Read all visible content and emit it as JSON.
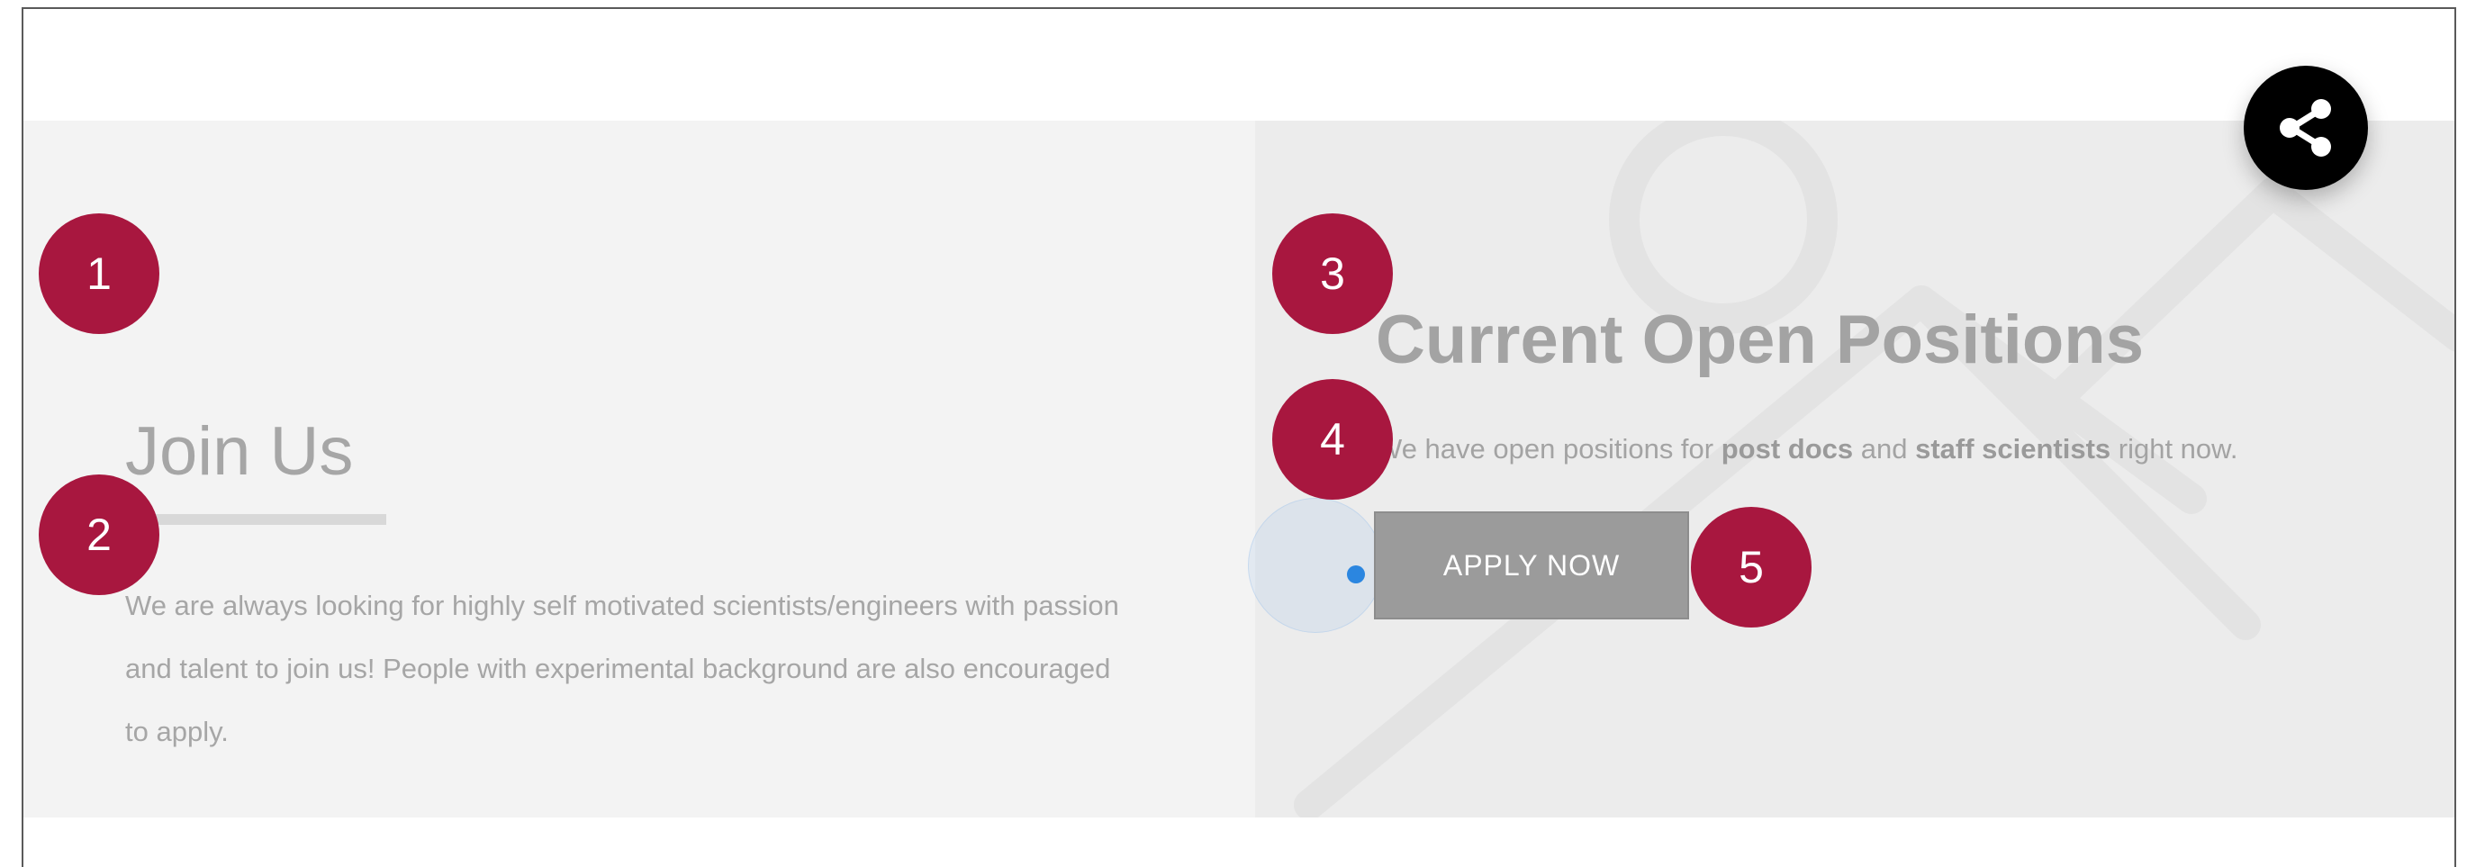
{
  "join": {
    "title": "Join Us",
    "text": "We are always looking for highly self motivated scientists/engineers with passion and talent to join us! People with experimental background are also encouraged to apply."
  },
  "positions": {
    "title": "Current Open Positions",
    "text_before": "We have open positions for ",
    "emph1": "post docs",
    "text_mid": " and ",
    "emph2": "staff scientists",
    "text_after": " right now.",
    "apply_label": "APPLY NOW"
  },
  "annotations": [
    "1",
    "2",
    "3",
    "4",
    "5"
  ],
  "icons": {
    "share": "share-icon"
  },
  "colors": {
    "badge": "#a8173f",
    "share_button": "#000000",
    "apply_button": "#9b9b9b",
    "cursor": "#2b86e0"
  }
}
